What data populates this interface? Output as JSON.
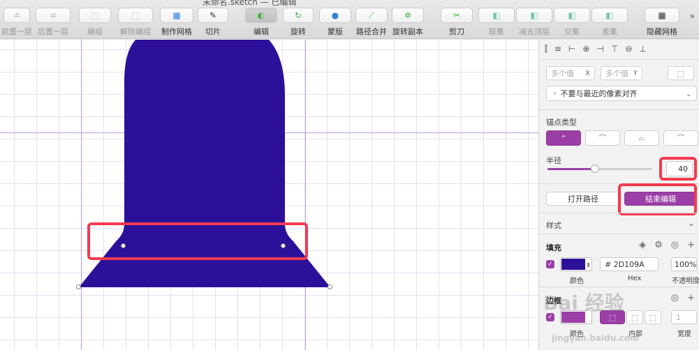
{
  "window": {
    "title": "未命名.sketch — 已编辑"
  },
  "toolbar": {
    "items": [
      {
        "label": "前置一层",
        "icon": "≐",
        "dim": true
      },
      {
        "label": "后置一层",
        "icon": "≑",
        "dim": true
      },
      {
        "label": "编组",
        "icon": "⬚",
        "dim": true
      },
      {
        "label": "解除编组",
        "icon": "⬚",
        "dim": true
      },
      {
        "label": "制作网格",
        "icon": "▦",
        "dim": false
      },
      {
        "label": "切片",
        "icon": "✎",
        "dim": false
      },
      {
        "label": "编辑",
        "icon": "◐",
        "dim": false,
        "active": true
      },
      {
        "label": "旋转",
        "icon": "↻",
        "dim": false
      },
      {
        "label": "蒙版",
        "icon": "●",
        "dim": false
      },
      {
        "label": "路径合并",
        "icon": "⟋",
        "dim": false
      },
      {
        "label": "旋转副本",
        "icon": "✲",
        "dim": false
      },
      {
        "label": "剪刀",
        "icon": "✂",
        "dim": false
      },
      {
        "label": "联集",
        "icon": "◧",
        "dim": true
      },
      {
        "label": "减去顶层",
        "icon": "◧",
        "dim": true
      },
      {
        "label": "交集",
        "icon": "◧",
        "dim": true
      },
      {
        "label": "差集",
        "icon": "◧",
        "dim": true
      },
      {
        "label": "隐藏网格",
        "icon": "▦",
        "dim": false
      }
    ],
    "overflow": "»"
  },
  "canvas": {
    "shape_color": "#2D109A",
    "highlight_color": "#F23A4E"
  },
  "inspector": {
    "x_placeholder": "多个值",
    "x_suffix": "X",
    "y_placeholder": "多个值",
    "y_suffix": "Y",
    "snap_option": "不要与最近的像素对齐",
    "anchor_label": "锚点类型",
    "radius_label": "半径",
    "radius_value": "40",
    "radius_fraction": 0.45,
    "open_path_label": "打开路径",
    "finish_edit_label": "结束编辑",
    "style_label": "样式",
    "fill_label": "填充",
    "fill_hex": "# 2D109A",
    "fill_opacity": "100%",
    "color_caption": "颜色",
    "hex_caption": "Hex",
    "opacity_caption": "不透明度",
    "border_label": "边框",
    "border_color_caption": "颜色",
    "border_position_caption": "内部",
    "border_width_value": "1",
    "border_width_caption": "宽度",
    "accent_color": "#9B3FA6"
  },
  "watermark": {
    "brand": "Bai 经验",
    "url": "jingyan.baidu.com"
  }
}
